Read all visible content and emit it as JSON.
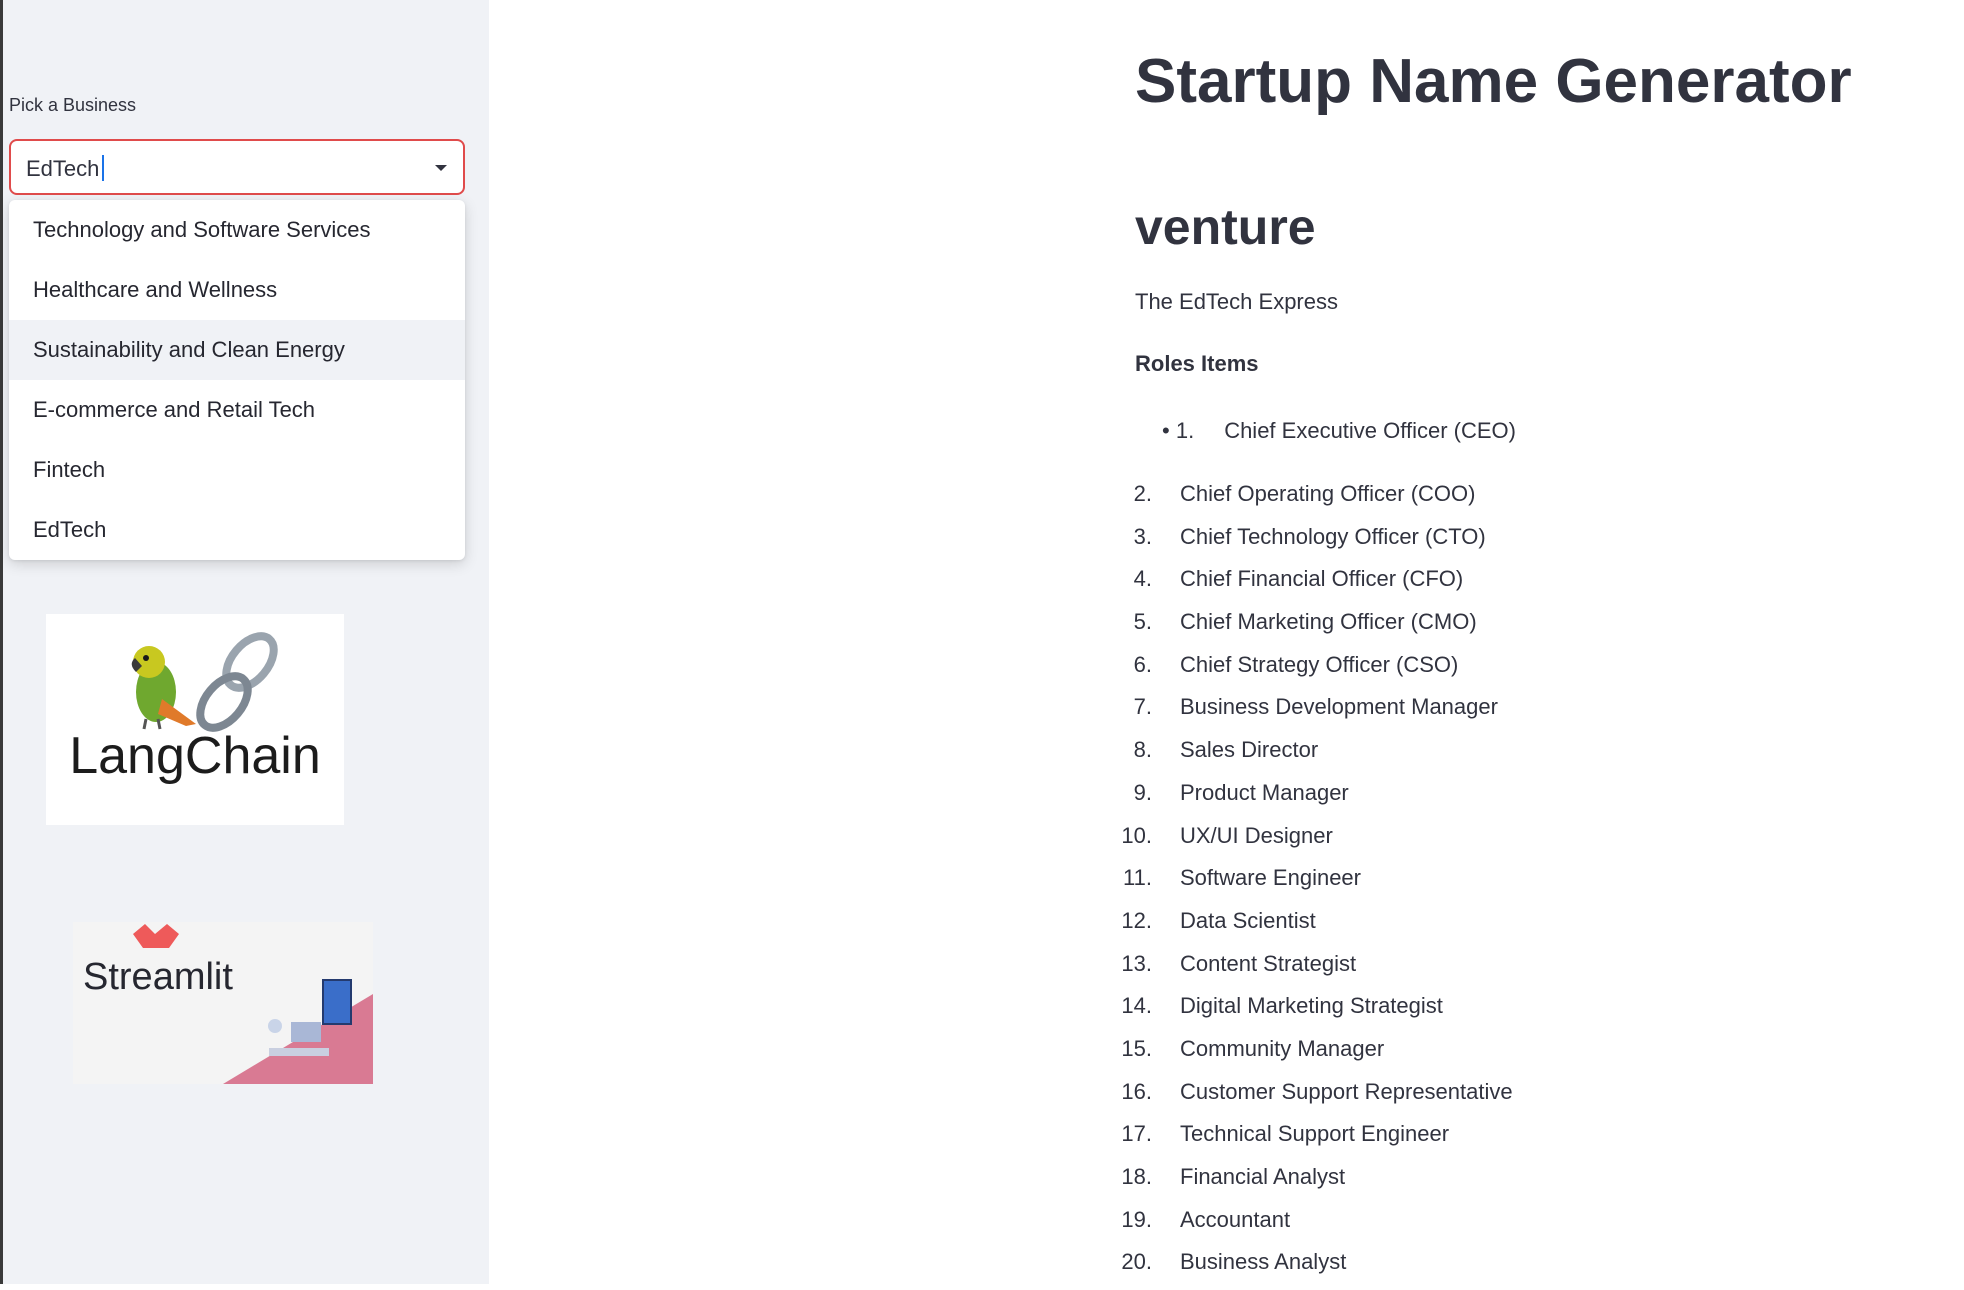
{
  "sidebar": {
    "select_label": "Pick a Business",
    "select_value": "EdTech",
    "options": [
      "Technology and Software Services",
      "Healthcare and Wellness",
      "Sustainability and Clean Energy",
      "E-commerce and Retail Tech",
      "Fintech",
      "EdTech"
    ],
    "highlighted_option": "Sustainability and Clean Energy",
    "logo_langchain_text": "LangChain",
    "logo_streamlit_text": "Streamlit"
  },
  "main": {
    "title": "Startup Name Generator",
    "subheading": "venture",
    "generated_name": "The EdTech Express",
    "roles_heading": "Roles Items",
    "roles": [
      {
        "num": "1.",
        "text": "Chief Executive Officer (CEO)"
      },
      {
        "num": "2.",
        "text": "Chief Operating Officer (COO)"
      },
      {
        "num": "3.",
        "text": "Chief Technology Officer (CTO)"
      },
      {
        "num": "4.",
        "text": "Chief Financial Officer (CFO)"
      },
      {
        "num": "5.",
        "text": "Chief Marketing Officer (CMO)"
      },
      {
        "num": "6.",
        "text": "Chief Strategy Officer (CSO)"
      },
      {
        "num": "7.",
        "text": "Business Development Manager"
      },
      {
        "num": "8.",
        "text": "Sales Director"
      },
      {
        "num": "9.",
        "text": "Product Manager"
      },
      {
        "num": "10.",
        "text": "UX/UI Designer"
      },
      {
        "num": "11.",
        "text": "Software Engineer"
      },
      {
        "num": "12.",
        "text": "Data Scientist"
      },
      {
        "num": "13.",
        "text": "Content Strategist"
      },
      {
        "num": "14.",
        "text": "Digital Marketing Strategist"
      },
      {
        "num": "15.",
        "text": "Community Manager"
      },
      {
        "num": "16.",
        "text": "Customer Support Representative"
      },
      {
        "num": "17.",
        "text": "Technical Support Engineer"
      },
      {
        "num": "18.",
        "text": "Financial Analyst"
      },
      {
        "num": "19.",
        "text": "Accountant"
      },
      {
        "num": "20.",
        "text": "Business Analyst"
      }
    ]
  }
}
